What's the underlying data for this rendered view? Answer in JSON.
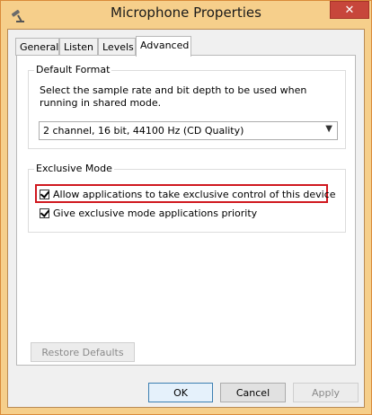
{
  "window": {
    "title": "Microphone Properties",
    "close_glyph": "✕"
  },
  "tabs": [
    {
      "label": "General",
      "active": false
    },
    {
      "label": "Listen",
      "active": false
    },
    {
      "label": "Levels",
      "active": false
    },
    {
      "label": "Advanced",
      "active": true
    }
  ],
  "default_format": {
    "title": "Default Format",
    "description": "Select the sample rate and bit depth to be used when running in shared mode.",
    "selected_value": "2 channel, 16 bit, 44100 Hz (CD Quality)"
  },
  "exclusive_mode": {
    "title": "Exclusive Mode",
    "options": [
      {
        "label": "Allow applications to take exclusive control of this device",
        "checked": true
      },
      {
        "label": "Give exclusive mode applications priority",
        "checked": true
      }
    ]
  },
  "restore_defaults_label": "Restore Defaults",
  "footer": {
    "ok_label": "OK",
    "cancel_label": "Cancel",
    "apply_label": "Apply"
  },
  "colors": {
    "titlebar": "#f6cf8b",
    "close_button": "#c7463b",
    "highlight_box": "#d0181f"
  }
}
